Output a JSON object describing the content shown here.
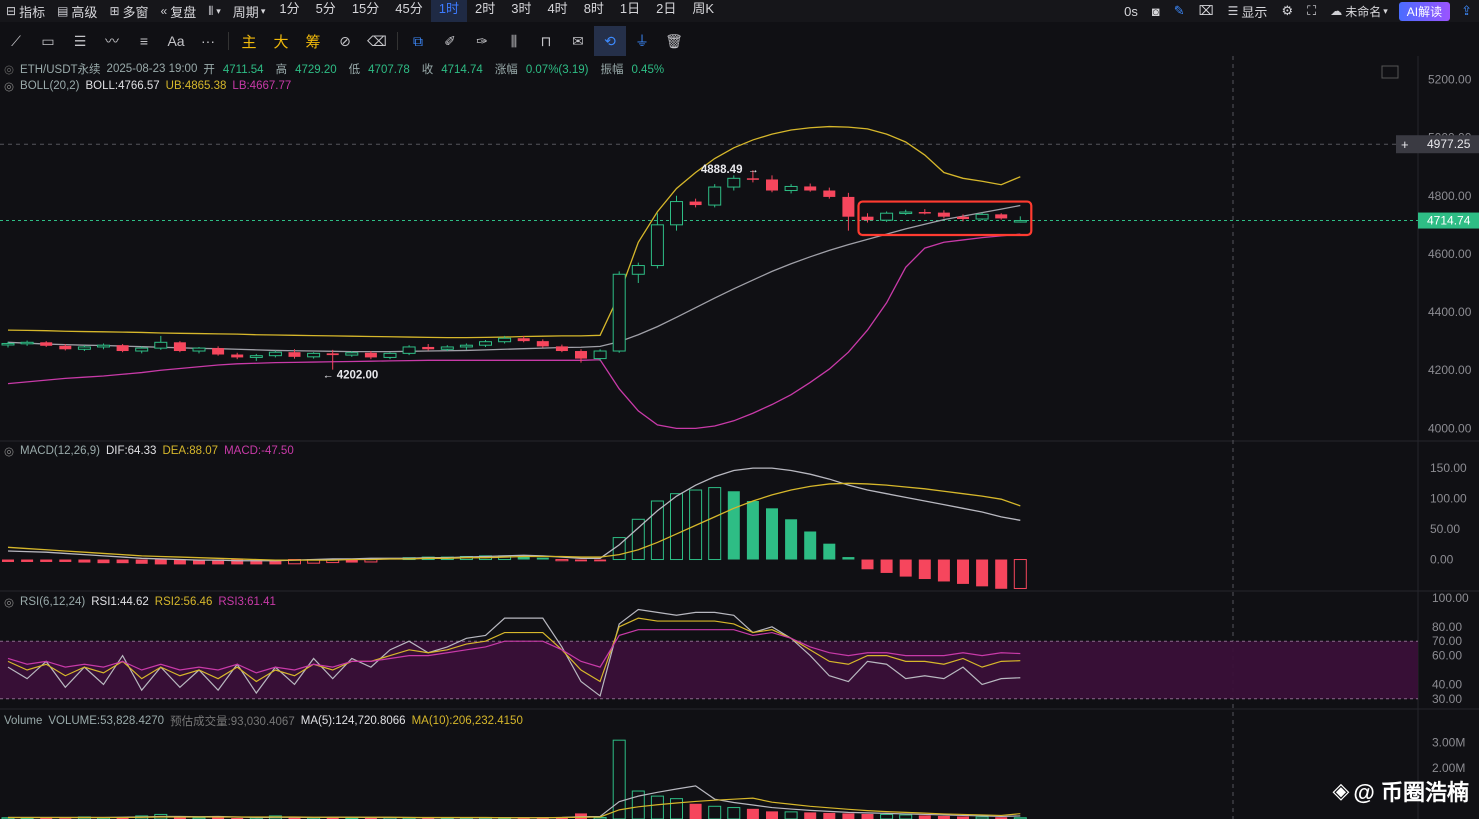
{
  "toolbar": {
    "indicators": "指标",
    "advanced": "高级",
    "multi_window": "多窗",
    "replay": "复盘",
    "period_menu": "周期",
    "periods": [
      "1分",
      "5分",
      "15分",
      "45分",
      "1时",
      "2时",
      "3时",
      "4时",
      "8时",
      "1日",
      "2日",
      "周K"
    ],
    "active_period": "1时",
    "countdown": "0s",
    "display": "显示",
    "unnamed": "未命名",
    "ai_button": "AI解读"
  },
  "drawtools": {
    "main": "主",
    "big": "大",
    "chips": "筹",
    "text_tool": "Aa",
    "more": "···"
  },
  "legend": {
    "symbol": "ETH/USDT永续",
    "datetime": "2025-08-23 19:00",
    "open_label": "开",
    "open": "4711.54",
    "high_label": "高",
    "high": "4729.20",
    "low_label": "低",
    "low": "4707.78",
    "close_label": "收",
    "close": "4714.74",
    "change_label": "涨幅",
    "change": "0.07%(3.19)",
    "amp_label": "振幅",
    "amp": "0.45%",
    "boll_name": "BOLL(20,2)",
    "boll_mid": "BOLL:4766.57",
    "boll_ub": "UB:4865.38",
    "boll_lb": "LB:4667.77",
    "macd_name": "MACD(12,26,9)",
    "dif": "DIF:64.33",
    "dea": "DEA:88.07",
    "macd": "MACD:-47.50",
    "rsi_name": "RSI(6,12,24)",
    "rsi1": "RSI1:44.62",
    "rsi2": "RSI2:56.46",
    "rsi3": "RSI3:61.41",
    "vol_name": "Volume",
    "volume": "VOLUME:53,828.4270",
    "est_volume": "预估成交量:93,030.4067",
    "ma5": "MA(5):124,720.8066",
    "ma10": "MA(10):206,232.4150"
  },
  "annotations": {
    "high_mark": "4888.49",
    "low_mark": "4202.00",
    "crosshair_price": "4977.25",
    "last_price": "4714.74"
  },
  "axes": {
    "price_ticks": [
      "5200.00",
      "5000.00",
      "4800.00",
      "4600.00",
      "4400.00",
      "4200.00",
      "4000.00"
    ],
    "macd_ticks": [
      "150.00",
      "100.00",
      "50.00",
      "0.00"
    ],
    "rsi_ticks": [
      "100.00",
      "80.00",
      "70.00",
      "60.00",
      "40.00",
      "30.00"
    ],
    "vol_ticks": [
      "3.00M",
      "2.00M"
    ]
  },
  "watermark": "@ 币圈浩楠",
  "colors": {
    "up": "#2ebd85",
    "down": "#f6465d",
    "boll_mid": "#a0a0a8",
    "boll_ub": "#d6b72b",
    "boll_lb": "#c83aa8",
    "active": "#3d7bff",
    "highlight_box": "#ff3b30"
  },
  "chart_data": {
    "type": "candlestick",
    "symbol": "ETH/USDT永续",
    "interval": "1时",
    "price_range": [
      3960,
      5260
    ],
    "candles": [
      [
        4288,
        4298,
        4278,
        4292
      ],
      [
        4292,
        4302,
        4284,
        4296
      ],
      [
        4296,
        4300,
        4280,
        4284
      ],
      [
        4284,
        4290,
        4268,
        4272
      ],
      [
        4272,
        4286,
        4266,
        4280
      ],
      [
        4280,
        4292,
        4272,
        4286
      ],
      [
        4286,
        4290,
        4262,
        4266
      ],
      [
        4266,
        4282,
        4258,
        4276
      ],
      [
        4276,
        4318,
        4270,
        4296
      ],
      [
        4296,
        4300,
        4262,
        4266
      ],
      [
        4266,
        4280,
        4258,
        4276
      ],
      [
        4276,
        4282,
        4250,
        4254
      ],
      [
        4254,
        4260,
        4238,
        4244
      ],
      [
        4244,
        4256,
        4232,
        4250
      ],
      [
        4250,
        4268,
        4244,
        4262
      ],
      [
        4262,
        4272,
        4240,
        4246
      ],
      [
        4246,
        4262,
        4240,
        4258
      ],
      [
        4258,
        4270,
        4202,
        4252
      ],
      [
        4252,
        4266,
        4246,
        4260
      ],
      [
        4260,
        4266,
        4238,
        4244
      ],
      [
        4244,
        4262,
        4238,
        4258
      ],
      [
        4258,
        4286,
        4252,
        4280
      ],
      [
        4280,
        4290,
        4268,
        4272
      ],
      [
        4272,
        4286,
        4266,
        4280
      ],
      [
        4280,
        4292,
        4270,
        4286
      ],
      [
        4286,
        4304,
        4280,
        4298
      ],
      [
        4298,
        4318,
        4292,
        4310
      ],
      [
        4310,
        4318,
        4296,
        4300
      ],
      [
        4300,
        4306,
        4278,
        4282
      ],
      [
        4282,
        4288,
        4262,
        4266
      ],
      [
        4266,
        4272,
        4226,
        4240
      ],
      [
        4240,
        4272,
        4232,
        4266
      ],
      [
        4266,
        4540,
        4260,
        4530
      ],
      [
        4530,
        4570,
        4500,
        4560
      ],
      [
        4560,
        4740,
        4550,
        4700
      ],
      [
        4700,
        4800,
        4680,
        4780
      ],
      [
        4780,
        4790,
        4760,
        4768
      ],
      [
        4768,
        4840,
        4760,
        4830
      ],
      [
        4830,
        4870,
        4818,
        4860
      ],
      [
        4860,
        4888,
        4846,
        4856
      ],
      [
        4856,
        4870,
        4812,
        4818
      ],
      [
        4818,
        4840,
        4808,
        4832
      ],
      [
        4832,
        4842,
        4814,
        4818
      ],
      [
        4818,
        4828,
        4790,
        4796
      ],
      [
        4796,
        4810,
        4680,
        4728
      ],
      [
        4728,
        4740,
        4708,
        4716
      ],
      [
        4716,
        4746,
        4710,
        4740
      ],
      [
        4740,
        4752,
        4734,
        4744
      ],
      [
        4744,
        4754,
        4736,
        4742
      ],
      [
        4742,
        4750,
        4722,
        4728
      ],
      [
        4728,
        4736,
        4712,
        4720
      ],
      [
        4720,
        4742,
        4716,
        4736
      ],
      [
        4736,
        4740,
        4718,
        4722
      ],
      [
        4711.54,
        4729.2,
        4707.78,
        4714.74
      ]
    ],
    "boll_upper": [
      4338,
      4337,
      4336,
      4334,
      4333,
      4332,
      4331,
      4330,
      4328,
      4327,
      4326,
      4325,
      4324,
      4322,
      4321,
      4320,
      4319,
      4318,
      4317,
      4316,
      4315,
      4314,
      4313,
      4312,
      4312,
      4313,
      4314,
      4316,
      4317,
      4318,
      4318,
      4320,
      4460,
      4640,
      4745,
      4825,
      4880,
      4928,
      4965,
      4992,
      5012,
      5026,
      5034,
      5038,
      5036,
      5030,
      5012,
      4985,
      4940,
      4880,
      4860,
      4850,
      4838,
      4865.38
    ],
    "boll_mid": [
      4296,
      4293,
      4290,
      4288,
      4286,
      4285,
      4283,
      4281,
      4279,
      4277,
      4275,
      4274,
      4272,
      4270,
      4268,
      4267,
      4266,
      4265,
      4264,
      4264,
      4264,
      4265,
      4266,
      4267,
      4268,
      4270,
      4272,
      4274,
      4276,
      4278,
      4279,
      4282,
      4298,
      4322,
      4350,
      4382,
      4415,
      4448,
      4480,
      4510,
      4540,
      4566,
      4590,
      4612,
      4632,
      4650,
      4668,
      4686,
      4702,
      4718,
      4730,
      4742,
      4754,
      4766.57
    ],
    "boll_lower": [
      4154,
      4160,
      4166,
      4172,
      4176,
      4180,
      4186,
      4192,
      4200,
      4206,
      4212,
      4218,
      4222,
      4224,
      4226,
      4227,
      4228,
      4229,
      4230,
      4231,
      4232,
      4233,
      4234,
      4234,
      4234,
      4234,
      4234,
      4234,
      4234,
      4234,
      4234,
      4236,
      4136,
      4060,
      4012,
      4000,
      4000,
      4008,
      4026,
      4052,
      4082,
      4116,
      4158,
      4204,
      4262,
      4338,
      4432,
      4554,
      4620,
      4640,
      4648,
      4656,
      4662,
      4667.77
    ],
    "macd": {
      "dif": [
        14,
        13,
        12,
        10,
        8,
        6,
        4,
        2,
        1,
        0,
        -1,
        -1,
        -2,
        -2,
        -2,
        -1,
        0,
        1,
        1,
        2,
        2,
        2,
        3,
        3,
        4,
        5,
        6,
        7,
        6,
        4,
        2,
        2,
        24,
        52,
        80,
        104,
        122,
        136,
        146,
        150,
        150,
        146,
        140,
        132,
        122,
        114,
        108,
        102,
        96,
        90,
        84,
        78,
        70,
        64.33
      ],
      "dea": [
        20,
        18,
        16,
        14,
        12,
        10,
        8,
        6,
        5,
        4,
        3,
        2,
        1,
        0,
        -1,
        -1,
        -1,
        -1,
        0,
        0,
        1,
        1,
        2,
        2,
        3,
        3,
        4,
        5,
        5,
        5,
        4,
        4,
        8,
        16,
        28,
        42,
        56,
        70,
        84,
        96,
        106,
        114,
        120,
        124,
        125,
        124,
        122,
        119,
        116,
        112,
        108,
        104,
        99,
        88.07
      ],
      "hist": [
        -4,
        -4,
        -4,
        -4,
        -5,
        -6,
        -6,
        -7,
        -8,
        -8,
        -8,
        -8,
        -8,
        -8,
        -8,
        -7,
        -6,
        -5,
        -5,
        -4,
        2,
        3,
        4,
        4,
        5,
        6,
        6,
        5,
        3,
        -2,
        -3,
        -3,
        36,
        66,
        96,
        108,
        114,
        118,
        112,
        96,
        84,
        66,
        46,
        26,
        4,
        -16,
        -22,
        -28,
        -32,
        -36,
        -40,
        -44,
        -48,
        -47.5
      ]
    },
    "rsi": {
      "rsi1": [
        52,
        44,
        56,
        38,
        52,
        40,
        60,
        36,
        52,
        38,
        50,
        36,
        54,
        34,
        52,
        40,
        58,
        44,
        58,
        52,
        64,
        70,
        62,
        66,
        72,
        74,
        86,
        86,
        86,
        66,
        42,
        32,
        82,
        92,
        90,
        88,
        90,
        90,
        88,
        76,
        80,
        72,
        60,
        46,
        42,
        56,
        54,
        44,
        46,
        44,
        52,
        40,
        44,
        44.62
      ],
      "rsi2": [
        56,
        50,
        54,
        46,
        52,
        48,
        56,
        44,
        52,
        46,
        50,
        44,
        52,
        42,
        50,
        46,
        54,
        50,
        56,
        56,
        60,
        64,
        62,
        64,
        68,
        70,
        76,
        76,
        76,
        64,
        50,
        42,
        80,
        86,
        84,
        84,
        84,
        84,
        82,
        76,
        78,
        72,
        64,
        56,
        54,
        60,
        60,
        56,
        56,
        54,
        58,
        52,
        56,
        56.46
      ],
      "rsi3": [
        58,
        54,
        56,
        52,
        54,
        52,
        56,
        50,
        54,
        50,
        52,
        50,
        54,
        48,
        52,
        50,
        54,
        52,
        56,
        56,
        58,
        60,
        60,
        62,
        64,
        66,
        70,
        70,
        70,
        64,
        56,
        52,
        74,
        78,
        78,
        78,
        78,
        78,
        78,
        74,
        76,
        72,
        66,
        62,
        60,
        62,
        62,
        60,
        60,
        60,
        62,
        60,
        62,
        61.41
      ]
    },
    "volume": {
      "values": [
        0.05,
        0.04,
        0.06,
        0.03,
        0.08,
        0.05,
        0.07,
        0.12,
        0.18,
        0.06,
        0.05,
        0.08,
        0.04,
        0.05,
        0.12,
        0.06,
        0.05,
        0.08,
        0.04,
        0.05,
        0.06,
        0.05,
        0.06,
        0.04,
        0.05,
        0.06,
        0.05,
        0.04,
        0.06,
        0.08,
        0.22,
        0.06,
        3.1,
        1.1,
        0.9,
        0.8,
        0.6,
        0.5,
        0.45,
        0.4,
        0.3,
        0.28,
        0.26,
        0.24,
        0.22,
        0.2,
        0.18,
        0.16,
        0.14,
        0.12,
        0.1,
        0.08,
        0.07,
        0.05
      ],
      "ma5": [
        0.06,
        0.06,
        0.06,
        0.06,
        0.06,
        0.06,
        0.07,
        0.08,
        0.1,
        0.1,
        0.09,
        0.1,
        0.08,
        0.06,
        0.07,
        0.07,
        0.06,
        0.07,
        0.07,
        0.06,
        0.06,
        0.06,
        0.05,
        0.05,
        0.05,
        0.05,
        0.05,
        0.05,
        0.05,
        0.06,
        0.09,
        0.1,
        0.68,
        0.9,
        1.05,
        1.18,
        1.3,
        0.78,
        0.65,
        0.55,
        0.45,
        0.39,
        0.34,
        0.3,
        0.26,
        0.24,
        0.22,
        0.2,
        0.18,
        0.16,
        0.14,
        0.12,
        0.1,
        0.12
      ],
      "ma10": [
        0.06,
        0.06,
        0.06,
        0.06,
        0.06,
        0.06,
        0.06,
        0.07,
        0.08,
        0.08,
        0.08,
        0.08,
        0.08,
        0.08,
        0.08,
        0.08,
        0.07,
        0.07,
        0.07,
        0.07,
        0.07,
        0.06,
        0.06,
        0.06,
        0.06,
        0.06,
        0.05,
        0.05,
        0.05,
        0.06,
        0.07,
        0.08,
        0.36,
        0.48,
        0.56,
        0.63,
        0.69,
        0.74,
        0.78,
        0.82,
        0.66,
        0.58,
        0.5,
        0.44,
        0.38,
        0.33,
        0.29,
        0.26,
        0.23,
        0.2,
        0.18,
        0.16,
        0.14,
        0.21
      ]
    }
  }
}
